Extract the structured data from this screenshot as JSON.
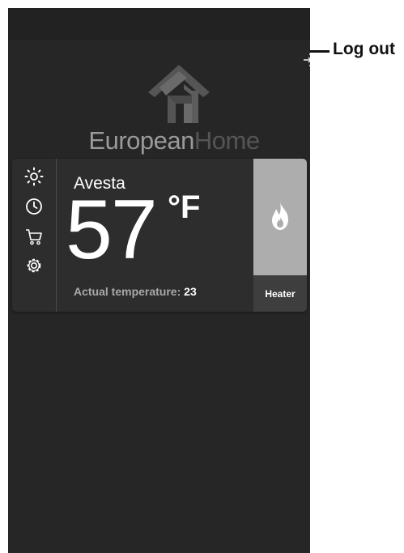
{
  "header": {
    "logout_label": "Log out",
    "logout_icon": "logout-icon"
  },
  "brand": {
    "name_part1": "European",
    "name_part2": "Home",
    "logo_icon": "house-logo-icon"
  },
  "thermostat": {
    "room": "Avesta",
    "temperature": "57",
    "unit": "°F",
    "actual_label": "Actual temperature:",
    "actual_value": "23",
    "mode_label": "Heater",
    "mode_icon": "flame-icon"
  },
  "side_menu": [
    {
      "icon": "sun-icon"
    },
    {
      "icon": "clock-icon"
    },
    {
      "icon": "cart-icon"
    },
    {
      "icon": "gear-icon"
    }
  ],
  "colors": {
    "app_background": "#262626",
    "card_background": "#2d2d2d",
    "heater_tile": "#adadad",
    "heater_label_bg": "#3e3e3e",
    "text_primary": "#ffffff",
    "text_secondary": "#a8a8a8"
  }
}
